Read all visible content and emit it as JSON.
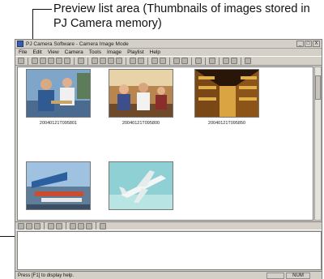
{
  "annotation": {
    "text": "Preview list area (Thumbnails of images stored in PJ Camera memory)"
  },
  "window": {
    "title": "PJ Camera Software - Camera Image Mode",
    "controls": [
      "_",
      "□",
      "X"
    ]
  },
  "menu": [
    "File",
    "Edit",
    "View",
    "Camera",
    "Tools",
    "Image",
    "Playlist",
    "Help"
  ],
  "thumbnails": [
    {
      "caption": "20040121T095801",
      "scene": "people-office"
    },
    {
      "caption": "20040121T095800",
      "scene": "workers-counter"
    },
    {
      "caption": "20040121T095850",
      "scene": "warehouse"
    },
    {
      "caption": "",
      "scene": "airport-terminal"
    },
    {
      "caption": "",
      "scene": "airplane-sky"
    }
  ],
  "statusbar": {
    "text": "Press [F1] to display help.",
    "num_indicator": "NUM"
  },
  "colors": {
    "window_face": "#d4d0c8",
    "pane_bg": "#ffffff",
    "app_icon": "#3a5fa8"
  }
}
